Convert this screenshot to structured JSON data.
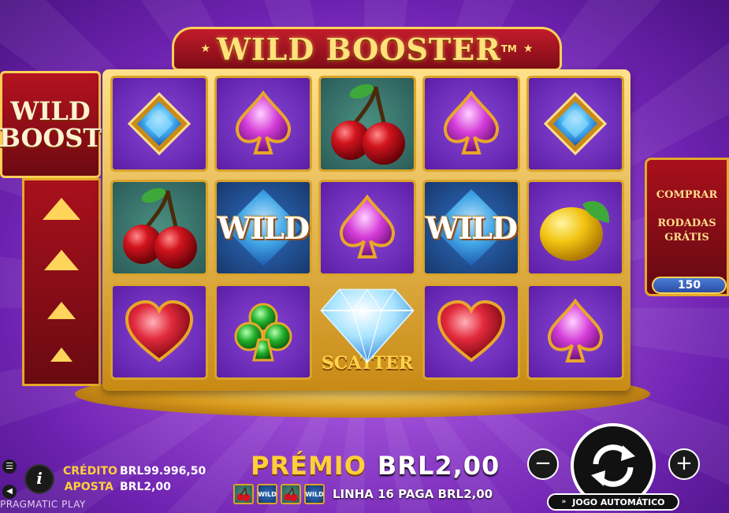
{
  "game": {
    "title": "WILD BOOSTER",
    "title_mark": "TM",
    "provider": "PRAGMATIC PLAY"
  },
  "left_panel": {
    "boost_line1": "WILD",
    "boost_line2": "BOOST"
  },
  "right_panel": {
    "buy_label": "COMPRAR",
    "free_spins_label_1": "RODADAS",
    "free_spins_label_2": "GRÁTIS",
    "price": "150"
  },
  "reels": {
    "wild_label": "WILD",
    "scatter_label": "SCATTER",
    "grid": [
      [
        "diamond-gem",
        "spade-pink",
        "cherry",
        "spade-pink",
        "diamond-gem"
      ],
      [
        "cherry",
        "wild",
        "spade-pink",
        "wild",
        "lemon"
      ],
      [
        "heart-red",
        "club-green",
        "scatter",
        "heart-red",
        "spade-pink"
      ]
    ]
  },
  "status": {
    "credit_label": "CRÉDITO",
    "credit_value": "BRL99.996,50",
    "bet_label": "APOSTA",
    "bet_value": "BRL2,00"
  },
  "win": {
    "prize_label": "PRÉMIO",
    "prize_value": "BRL2,00",
    "line_text": "LINHA 16 PAGA BRL2,00",
    "line_symbols": [
      "cherry",
      "wild",
      "cherry",
      "wild"
    ]
  },
  "controls": {
    "minus": "−",
    "plus": "+",
    "autoplay_label": "JOGO AUTOMÁTICO",
    "info": "i"
  },
  "colors": {
    "accent_gold": "#ffcf3a",
    "frame_red": "#a8101c",
    "background_purple": "#9b4bd4"
  }
}
